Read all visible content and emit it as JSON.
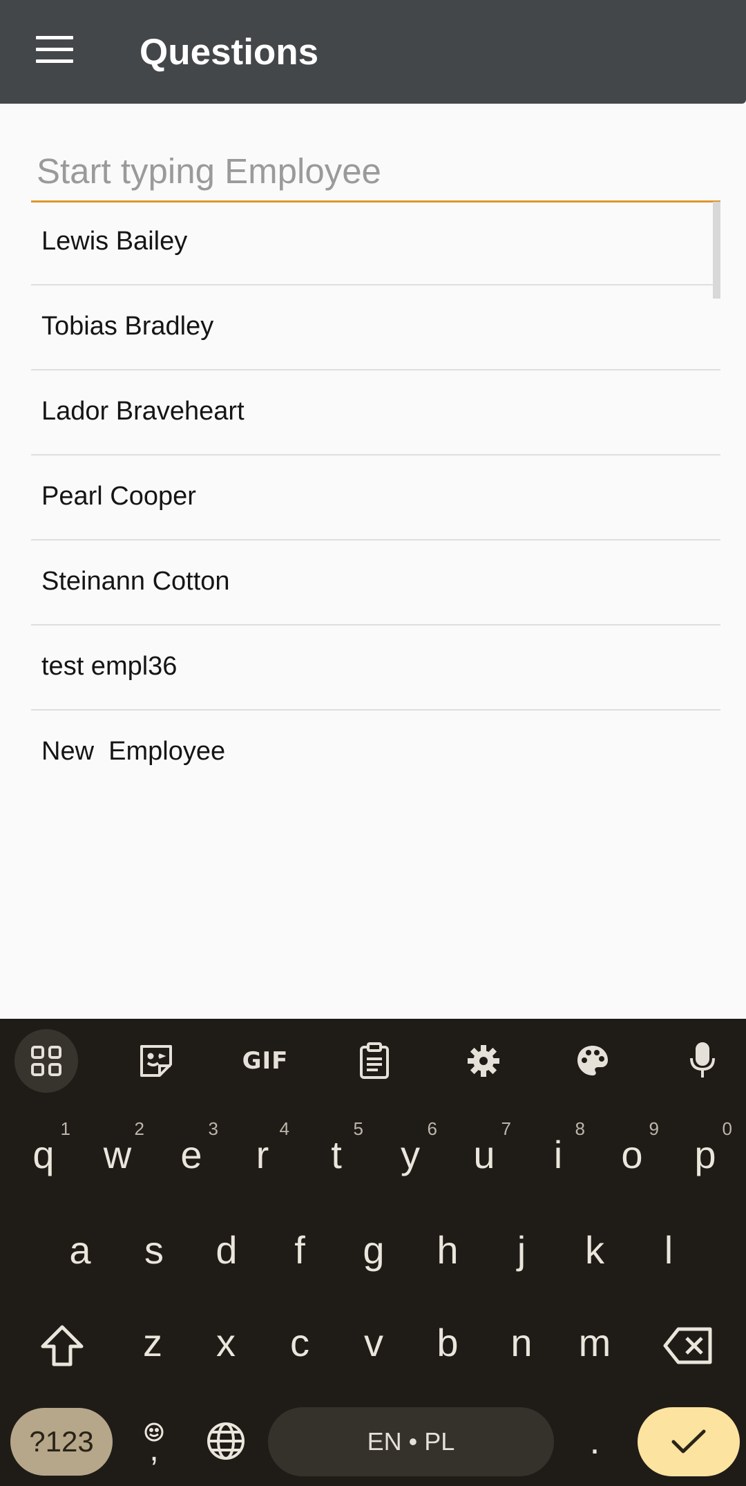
{
  "app_bar": {
    "title": "Questions",
    "menu_icon": "hamburger-menu-icon"
  },
  "search": {
    "placeholder": "Start typing Employee",
    "value": ""
  },
  "employees": [
    "Lewis Bailey",
    "Tobias Bradley",
    "Lador Braveheart",
    "Pearl Cooper",
    "Steinann Cotton",
    "test empl36",
    "New  Employee"
  ],
  "keyboard": {
    "toolbar": [
      "apps-grid-icon",
      "sticker-icon",
      "gif-icon",
      "clipboard-icon",
      "settings-gear-icon",
      "palette-icon",
      "microphone-icon"
    ],
    "gif_label": "GIF",
    "row1": [
      {
        "key": "q",
        "hint": "1"
      },
      {
        "key": "w",
        "hint": "2"
      },
      {
        "key": "e",
        "hint": "3"
      },
      {
        "key": "r",
        "hint": "4"
      },
      {
        "key": "t",
        "hint": "5"
      },
      {
        "key": "y",
        "hint": "6"
      },
      {
        "key": "u",
        "hint": "7"
      },
      {
        "key": "i",
        "hint": "8"
      },
      {
        "key": "o",
        "hint": "9"
      },
      {
        "key": "p",
        "hint": "0"
      }
    ],
    "row2": [
      "a",
      "s",
      "d",
      "f",
      "g",
      "h",
      "j",
      "k",
      "l"
    ],
    "row3": [
      "z",
      "x",
      "c",
      "v",
      "b",
      "n",
      "m"
    ],
    "symbols_label": "?123",
    "comma_label": ",",
    "space_label": "EN • PL",
    "period_label": ".",
    "accent_color": "#fde3a0"
  }
}
